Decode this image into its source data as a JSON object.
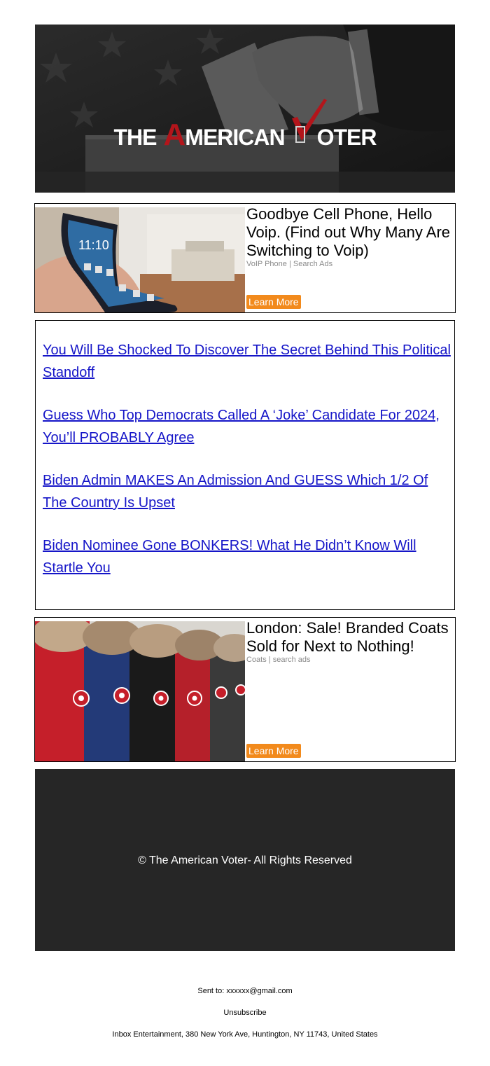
{
  "header": {
    "logo_parts": {
      "the": "THE",
      "a": "A",
      "merican": "MERICAN",
      "v": "V",
      "oter": "OTER"
    },
    "colors": {
      "logo_red": "#b3151b",
      "banner_bg": "#1e1e1e"
    }
  },
  "ads": [
    {
      "headline": "Goodbye Cell Phone, Hello Voip. (Find out Why Many Are Switching to Voip)",
      "source": "VoIP Phone | Search Ads",
      "button": "Learn More",
      "image": "flexible-phone-photo"
    },
    {
      "headline": "London: Sale! Branded Coats Sold for Next to Nothing!",
      "source": "Coats | search ads",
      "button": "Learn More",
      "image": "parka-coats-photo"
    }
  ],
  "links": [
    "You Will Be Shocked To Discover The Secret Behind This Political Standoff",
    "Guess Who Top Democrats Called A ‘Joke’ Candidate For 2024, You’ll PROBABLY Agree",
    "Biden Admin MAKES An Admission And GUESS Which 1/2 Of The Country Is Upset",
    "Biden Nominee Gone BONKERS! What He Didn’t Know Will Startle You"
  ],
  "footer": {
    "copyright": "© The American Voter- All Rights Reserved",
    "sent_to": "Sent to: xxxxxx@gmail.com",
    "unsubscribe": "Unsubscribe",
    "address": "Inbox Entertainment, 380 New York Ave, Huntington, NY 11743, United States"
  },
  "accent_colors": {
    "button_orange": "#f28a1c",
    "link_blue": "#1515c8",
    "footer_dark": "#262626"
  }
}
